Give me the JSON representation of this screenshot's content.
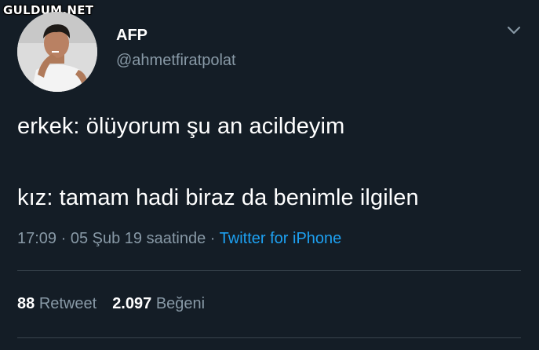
{
  "watermark": "GULDUM.NET",
  "user": {
    "name": "AFP",
    "handle": "@ahmetfiratpolat"
  },
  "tweet": {
    "line1": "erkek: ölüyorum şu an acildeyim",
    "line2": "kız: tamam hadi biraz da benimle ilgilen"
  },
  "meta": {
    "time": "17:09",
    "date": "05 Şub 19 saatinde",
    "separator": "·",
    "source": "Twitter for iPhone"
  },
  "stats": {
    "retweets_count": "88",
    "retweets_label": "Retweet",
    "likes_count": "2.097",
    "likes_label": "Beğeni"
  },
  "colors": {
    "background": "#141d26",
    "secondary_text": "#8899a6",
    "link": "#1da1f2",
    "divider": "#38444d"
  },
  "icons": {
    "caret": "chevron-down-icon"
  }
}
